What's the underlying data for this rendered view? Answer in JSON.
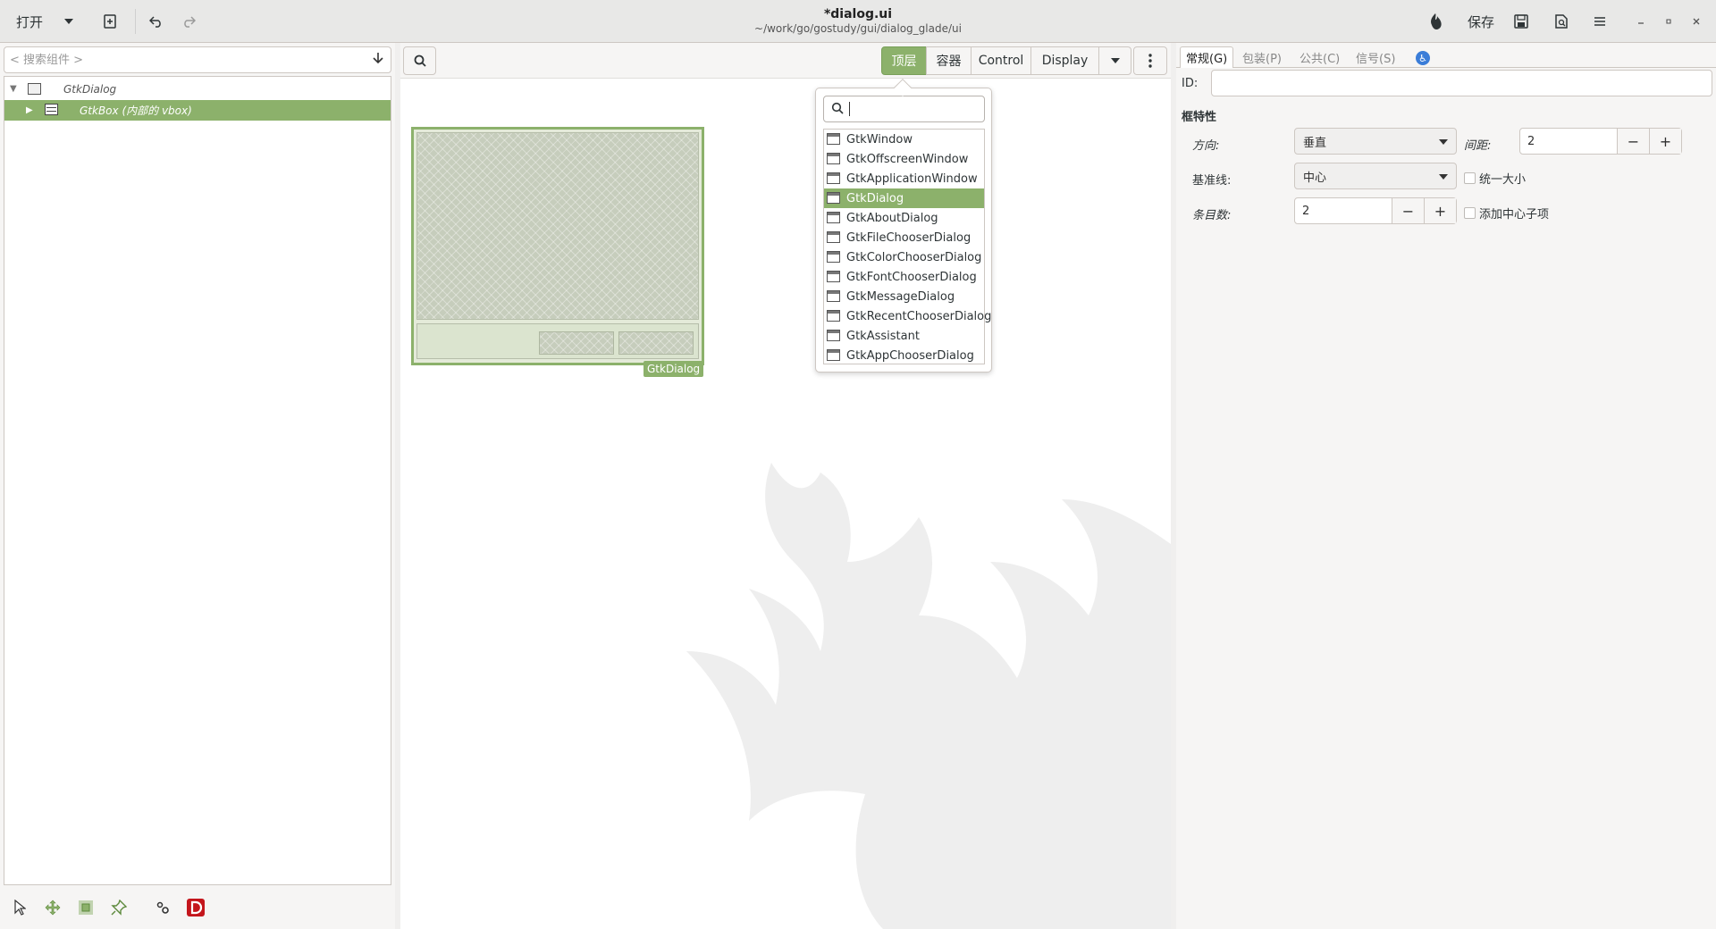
{
  "header": {
    "open_label": "打开",
    "title": "*dialog.ui",
    "subtitle": "~/work/go/gostudy/gui/dialog_glade/ui",
    "save_label": "保存"
  },
  "left": {
    "search_placeholder": "< 搜索组件 >",
    "tree": [
      {
        "label": "GtkDialog",
        "expanded": true,
        "selected": false
      },
      {
        "label": "GtkBox (内部的 vbox)",
        "expanded": false,
        "selected": true
      }
    ]
  },
  "toolbar": {
    "segments": [
      "顶层",
      "容器",
      "Control",
      "Display"
    ],
    "active_segment": "顶层"
  },
  "canvas": {
    "widget_tag": "GtkDialog"
  },
  "popover": {
    "search_value": "",
    "items": [
      "GtkWindow",
      "GtkOffscreenWindow",
      "GtkApplicationWindow",
      "GtkDialog",
      "GtkAboutDialog",
      "GtkFileChooserDialog",
      "GtkColorChooserDialog",
      "GtkFontChooserDialog",
      "GtkMessageDialog",
      "GtkRecentChooserDialog",
      "GtkAssistant",
      "GtkAppChooserDialog"
    ],
    "selected": "GtkDialog"
  },
  "properties": {
    "tabs": [
      "常规(G)",
      "包装(P)",
      "公共(C)",
      "信号(S)"
    ],
    "active_tab": "常规(G)",
    "id_label": "ID:",
    "id_value": "",
    "section_title": "框特性",
    "orientation_label": "方向:",
    "orientation_value": "垂直",
    "spacing_label": "间距:",
    "spacing_value": "2",
    "baseline_label": "基准线:",
    "baseline_value": "中心",
    "homogeneous_label": "统一大小",
    "items_label": "条目数:",
    "items_value": "2",
    "center_child_label": "添加中心子项"
  },
  "colors": {
    "accent": "#8cb16b"
  }
}
